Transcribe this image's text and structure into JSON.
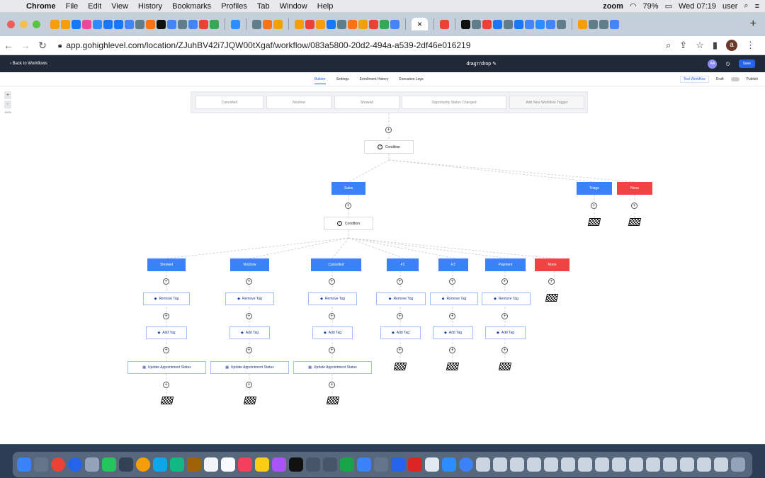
{
  "menubar": {
    "app": "Chrome",
    "items": [
      "File",
      "Edit",
      "View",
      "History",
      "Bookmarks",
      "Profiles",
      "Tab",
      "Window",
      "Help"
    ],
    "zoom_label": "zoom",
    "battery": "79%",
    "clock": "Wed 07:19",
    "user": "user"
  },
  "browser": {
    "active_tab_close": "×",
    "new_tab": "+",
    "url": "app.gohighlevel.com/location/ZJuhBV42i7JQW00tXgaf/workflow/083a5800-20d2-494a-a539-2df46e016219",
    "profile_initial": "a"
  },
  "app": {
    "back_label": "Back to Workflows",
    "workflow_name": "drag'n'drop",
    "user_initials": "AA",
    "save_label": "Save",
    "tabs": [
      "Builder",
      "Settings",
      "Enrollment History",
      "Execution Logs"
    ],
    "test_workflow": "Test Workflow",
    "draft": "Draft",
    "publish": "Publish"
  },
  "canvas": {
    "zoom_plus": "+",
    "zoom_minus": "-",
    "zoom_pct": "100%",
    "triggers": [
      "Cancelled",
      "Noshow",
      "Showed",
      "Opportunity Status Changed",
      "Add New Workflow Trigger"
    ],
    "condition_label": "Condition",
    "plus": "+",
    "top_branches": [
      "Sales",
      "Triage",
      "None"
    ],
    "sub_branches": [
      "Showed",
      "Noshow",
      "Cancelled",
      "F1",
      "F2",
      "Payment",
      "None"
    ],
    "action_remove_tag": "Remove Tag",
    "action_add_tag": "Add Tag",
    "action_update_status": "Update Appointment Status"
  },
  "colors": {
    "branch_blue": "#3b82f6",
    "branch_red": "#ef4444",
    "header_dark": "#1f2937",
    "accent": "#2563eb"
  },
  "icons": [
    "apple-icon",
    "back-arrow-icon",
    "forward-arrow-icon",
    "reload-icon",
    "lock-icon",
    "search-icon",
    "share-icon",
    "star-icon",
    "help-icon",
    "tag-icon",
    "condition-icon",
    "finish-flag-icon",
    "calendar-icon"
  ]
}
